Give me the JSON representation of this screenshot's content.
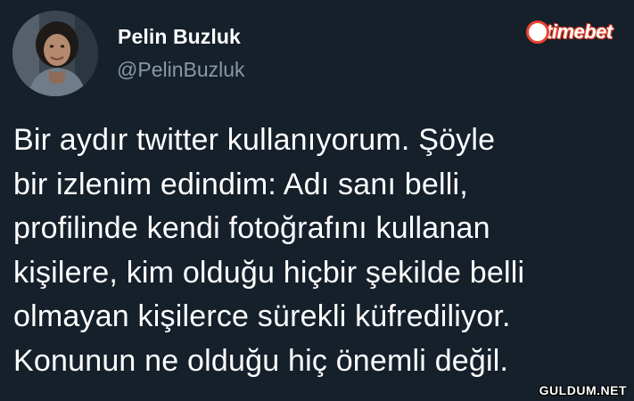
{
  "theme": {
    "background": "#15202b",
    "text_primary": "#ffffff",
    "text_secondary": "#8899a6",
    "brand_accent": "#e8452c"
  },
  "author": {
    "display_name": "Pelin Buzluk",
    "handle": "@PelinBuzluk",
    "avatar_icon": "user-avatar-photo"
  },
  "overlay": {
    "brand_logo_text": "timebet",
    "watermark_text": "GULDUM.NET"
  },
  "tweet": {
    "lines": [
      "Bir aydır twitter kullanıyorum. Şöyle",
      "bir izlenim edindim: Adı sanı belli,",
      "profilinde kendi fotoğrafını kullanan",
      "kişilere, kim olduğu hiçbir şekilde belli",
      "olmayan kişilerce sürekli küfrediliyor.",
      "Konunun ne olduğu hiç önemli değil."
    ]
  }
}
